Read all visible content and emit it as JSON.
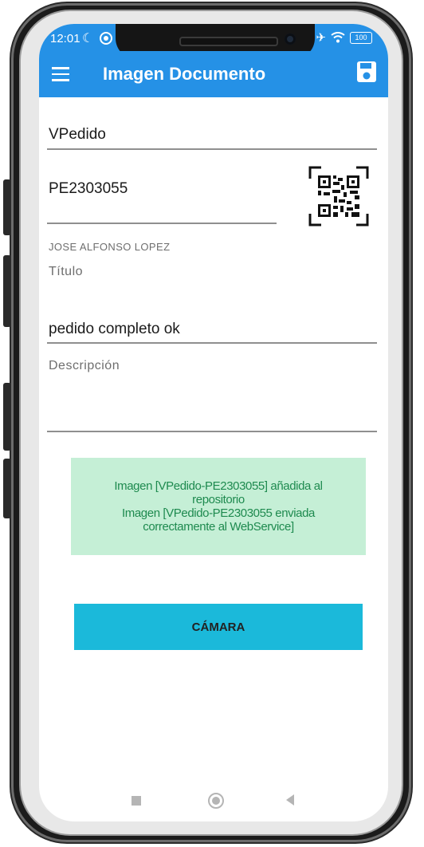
{
  "status_bar": {
    "time": "12:01",
    "battery": "100"
  },
  "app_bar": {
    "title": "Imagen Documento"
  },
  "form": {
    "document_type": "VPedido",
    "document_number": "PE2303055",
    "user_name": "JOSE ALFONSO LOPEZ",
    "title_label": "Título",
    "title_value": "pedido completo ok",
    "description_label": "Descripción",
    "description_value": ""
  },
  "message": {
    "line1": "Imagen [VPedido-PE2303055] añadida al",
    "line2": "repositorio",
    "line3": "Imagen [VPedido-PE2303055 enviada",
    "line4": "correctamente al WebService]"
  },
  "camera_button": {
    "label": "CÁMARA"
  },
  "colors": {
    "app_bar": "#2591e6",
    "message_bg": "#c5efd6",
    "message_text": "#1e8a4f",
    "camera_button": "#1bb9da"
  },
  "icons": {
    "menu": "menu-icon",
    "save": "save-icon",
    "qr": "qr-code-icon"
  }
}
